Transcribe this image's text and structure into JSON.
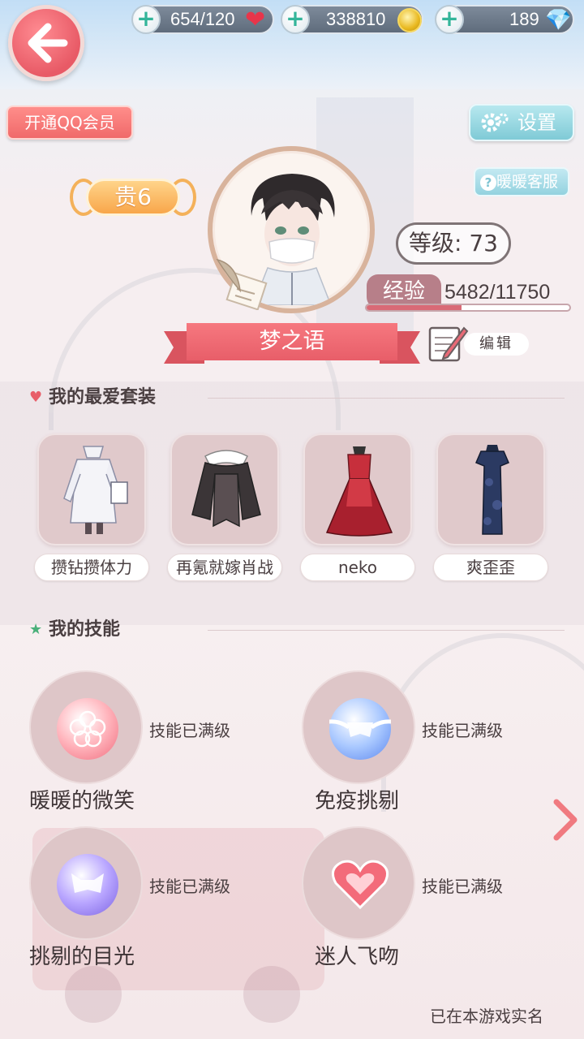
{
  "resources": {
    "stamina": "654/120",
    "gold": "338810",
    "diamonds": "189"
  },
  "header": {
    "qq_vip_label": "开通QQ会员",
    "settings_label": "设置",
    "customer_service_label": "暖暖客服"
  },
  "profile": {
    "vip_badge": "贵6",
    "level_text": "等级: 73",
    "exp_label": "经验",
    "exp_value": "5482/11750",
    "exp_progress": 0.466,
    "name": "梦之语",
    "edit_label": "编辑"
  },
  "favorites": {
    "title": "我的最爱套装",
    "items": [
      {
        "label": "攒钻攒体力"
      },
      {
        "label": "再氪就嫁肖战"
      },
      {
        "label": "neko"
      },
      {
        "label": "爽歪歪"
      }
    ]
  },
  "skills": {
    "title": "我的技能",
    "items": [
      {
        "name": "暖暖的微笑",
        "status": "技能已满级"
      },
      {
        "name": "免疫挑剔",
        "status": "技能已满级"
      },
      {
        "name": "挑剔的目光",
        "status": "技能已满级"
      },
      {
        "name": "迷人飞吻",
        "status": "技能已满级"
      }
    ]
  },
  "footer": {
    "realname_note": "已在本游戏实名"
  },
  "colors": {
    "accent_red": "#e85e69",
    "button_teal": "#7fcad6",
    "vip_orange": "#f8a64a"
  }
}
